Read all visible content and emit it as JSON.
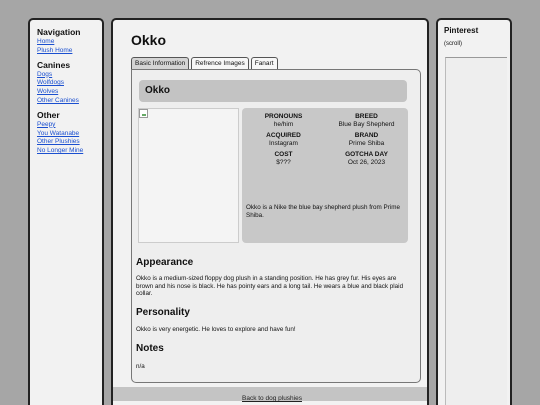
{
  "nav": {
    "title": "Navigation",
    "top_links": [
      "Home",
      "Plush Home"
    ],
    "canines": {
      "title": "Canines",
      "links": [
        "Dogs",
        "Wolfdogs",
        "Wolves",
        "Other Canines"
      ]
    },
    "other": {
      "title": "Other",
      "links": [
        "Peepy",
        "You Watanabe",
        "Other Plushies",
        "No Longer Mine"
      ]
    }
  },
  "pinterest": {
    "title": "Pinterest",
    "scroll_label": "(scroll)"
  },
  "main": {
    "title": "Okko",
    "tabs": [
      {
        "label": "Basic Information",
        "active": true
      },
      {
        "label": "Refrence Images",
        "active": false
      },
      {
        "label": "Fanart",
        "active": false
      }
    ],
    "name": "Okko",
    "info": [
      {
        "label": "PRONOUNS",
        "value": "he/him"
      },
      {
        "label": "BREED",
        "value": "Blue Bay Shepherd"
      },
      {
        "label": "ACQUIRED",
        "value": "Instagram"
      },
      {
        "label": "BRAND",
        "value": "Prime Shiba"
      },
      {
        "label": "COST",
        "value": "$???"
      },
      {
        "label": "GOTCHA DAY",
        "value": "Oct 26, 2023"
      }
    ],
    "description": "Okko is a Nike the blue bay shepherd plush from Prime Shiba.",
    "appearance": {
      "title": "Appearance",
      "text": "Okko is a medium-sized floppy dog plush in a standing position. He has grey fur. His eyes are brown and his nose is black. He has pointy ears and a long tail. He wears a blue and black plaid collar."
    },
    "personality": {
      "title": "Personality",
      "text": "Okko is very energetic. He loves to explore and have fun!"
    },
    "notes": {
      "title": "Notes",
      "text": "n/a"
    },
    "footer_link": "Back to dog plushies"
  }
}
